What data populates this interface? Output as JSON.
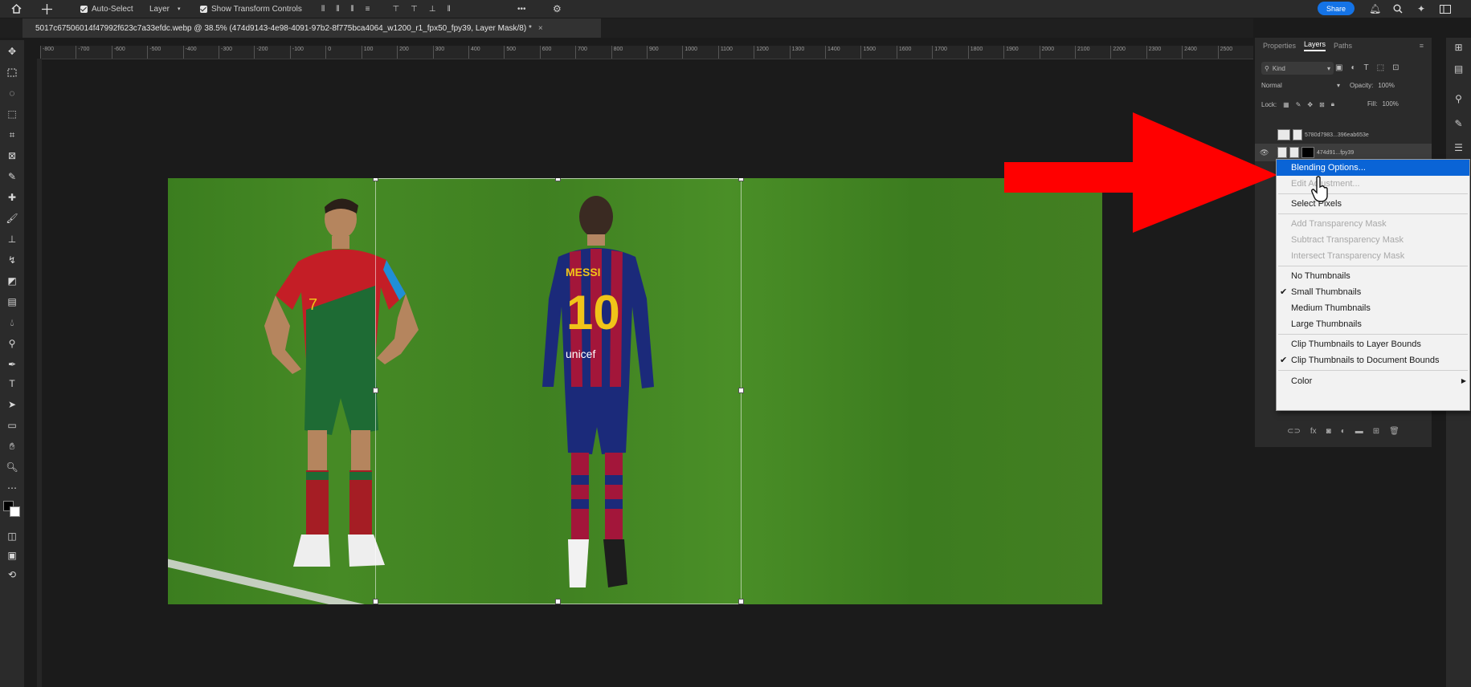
{
  "options_bar": {
    "auto_select_label": "Auto-Select",
    "layer_select": "Layer",
    "show_transform_label": "Show Transform Controls",
    "more_label": "•••",
    "share_label": "Share"
  },
  "document": {
    "tab_title": "5017c67506014f47992f623c7a33efdc.webp @ 38.5% (474d9143-4e98-4091-97b2-8f775bca4064_w1200_r1_fpx50_fpy39, Layer Mask/8) *",
    "close_glyph": "×"
  },
  "ruler": {
    "ticks": [
      "-800",
      "-700",
      "-600",
      "-500",
      "-400",
      "-300",
      "-200",
      "-100",
      "0",
      "100",
      "200",
      "300",
      "400",
      "500",
      "600",
      "700",
      "800",
      "900",
      "1000",
      "1100",
      "1200",
      "1300",
      "1400",
      "1500",
      "1600",
      "1700",
      "1800",
      "1900",
      "2000",
      "2100",
      "2200",
      "2300",
      "2400",
      "2500"
    ]
  },
  "panel": {
    "tabs": [
      "Properties",
      "Layers",
      "Paths"
    ],
    "active_tab": "Layers",
    "kind_label": "Kind",
    "blend_mode": "Normal",
    "opacity_label": "Opacity:",
    "opacity_value": "100%",
    "lock_label": "Lock:",
    "fill_label": "Fill:",
    "fill_value": "100%",
    "layers": [
      {
        "name": "5780d7983...396eab653e"
      },
      {
        "name": "474d91...fpy39"
      }
    ]
  },
  "context_menu": {
    "items": [
      {
        "label": "Blending Options...",
        "state": "highlighted"
      },
      {
        "label": "Edit Adjustment...",
        "state": "disabled"
      },
      {
        "label": "Select Pixels",
        "state": "enabled"
      },
      {
        "label": "Add Transparency Mask",
        "state": "disabled"
      },
      {
        "label": "Subtract Transparency Mask",
        "state": "disabled"
      },
      {
        "label": "Intersect Transparency Mask",
        "state": "disabled"
      },
      {
        "label": "No Thumbnails",
        "state": "enabled"
      },
      {
        "label": "Small Thumbnails",
        "state": "checked"
      },
      {
        "label": "Medium Thumbnails",
        "state": "enabled"
      },
      {
        "label": "Large Thumbnails",
        "state": "enabled"
      },
      {
        "label": "Clip Thumbnails to Layer Bounds",
        "state": "enabled"
      },
      {
        "label": "Clip Thumbnails to Document Bounds",
        "state": "checked"
      },
      {
        "label": "Color",
        "state": "submenu"
      }
    ],
    "check_glyph": "✔",
    "submenu_glyph": "▶"
  },
  "canvas": {
    "jersey_left_number": "7",
    "jersey_right_name": "MESSI",
    "jersey_right_number": "10",
    "sponsor": "unicef"
  },
  "colors": {
    "accent": "#1473e6",
    "highlight": "#0a64d6",
    "arrow": "#ff0000",
    "pitch": "#3a7a1f"
  }
}
